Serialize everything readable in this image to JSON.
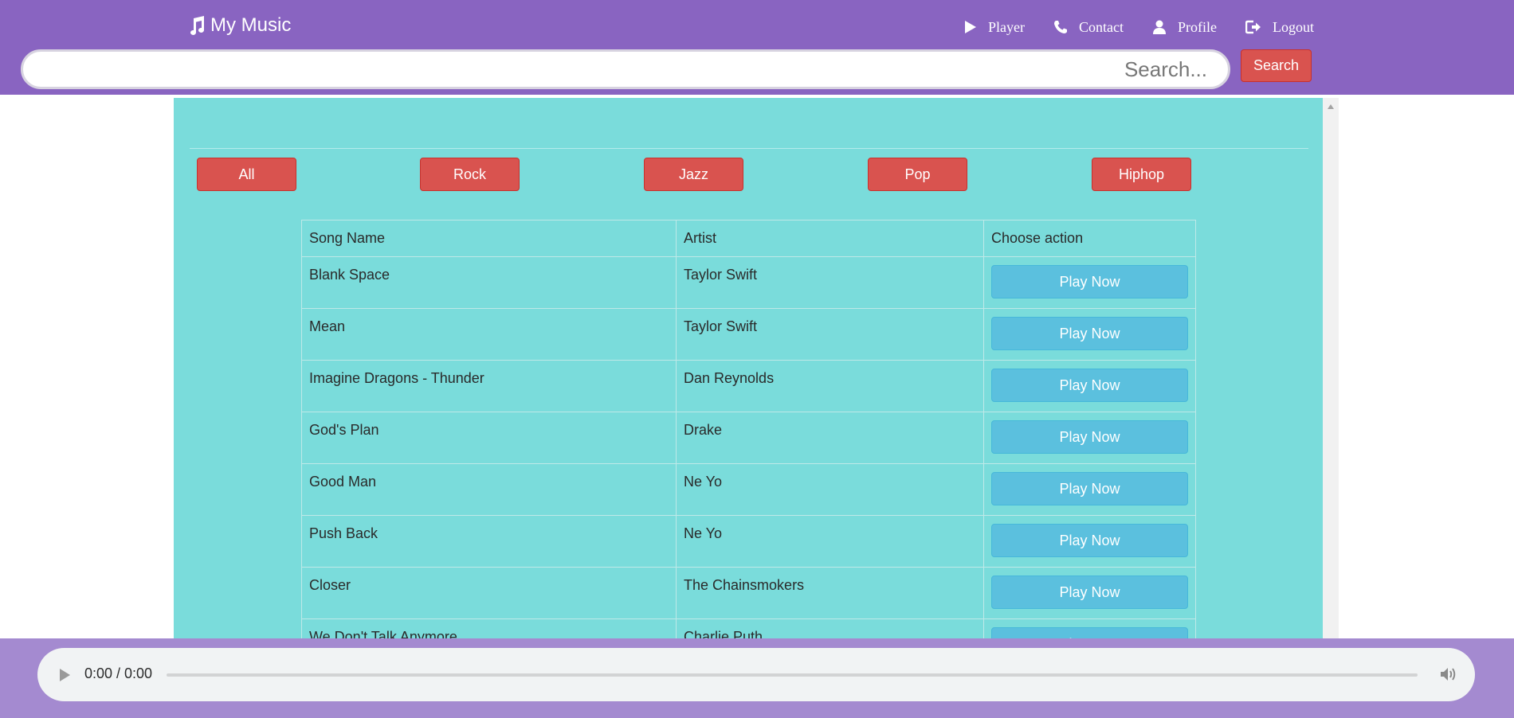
{
  "brand": {
    "title": "My Music"
  },
  "nav": {
    "items": [
      {
        "label": "Player",
        "icon": "play-icon"
      },
      {
        "label": "Contact",
        "icon": "phone-icon"
      },
      {
        "label": "Profile",
        "icon": "user-icon"
      },
      {
        "label": "Logout",
        "icon": "logout-icon"
      }
    ]
  },
  "search": {
    "placeholder": "Search...",
    "value": "",
    "button_label": "Search"
  },
  "genres": [
    "All",
    "Rock",
    "Jazz",
    "Pop",
    "Hiphop"
  ],
  "table": {
    "headers": [
      "Song Name",
      "Artist",
      "Choose action"
    ],
    "rows": [
      {
        "song": "Blank Space",
        "artist": "Taylor Swift",
        "action": "Play Now"
      },
      {
        "song": "Mean",
        "artist": "Taylor Swift",
        "action": "Play Now"
      },
      {
        "song": "Imagine Dragons - Thunder",
        "artist": "Dan Reynolds",
        "action": "Play Now"
      },
      {
        "song": "God's Plan",
        "artist": "Drake",
        "action": "Play Now"
      },
      {
        "song": "Good Man",
        "artist": "Ne Yo",
        "action": "Play Now"
      },
      {
        "song": "Push Back",
        "artist": "Ne Yo",
        "action": "Play Now"
      },
      {
        "song": "Closer",
        "artist": "The Chainsmokers",
        "action": "Play Now"
      },
      {
        "song": "We Don't Talk Anymore",
        "artist": "Charlie Puth",
        "action": "Play Now"
      }
    ]
  },
  "player": {
    "time": "0:00 / 0:00",
    "progress": 0
  },
  "colors": {
    "navbar": "#8964c1",
    "panel": "#7adcdb",
    "danger": "#d9534f",
    "info": "#5bc0de",
    "footer": "#a48ad0"
  }
}
